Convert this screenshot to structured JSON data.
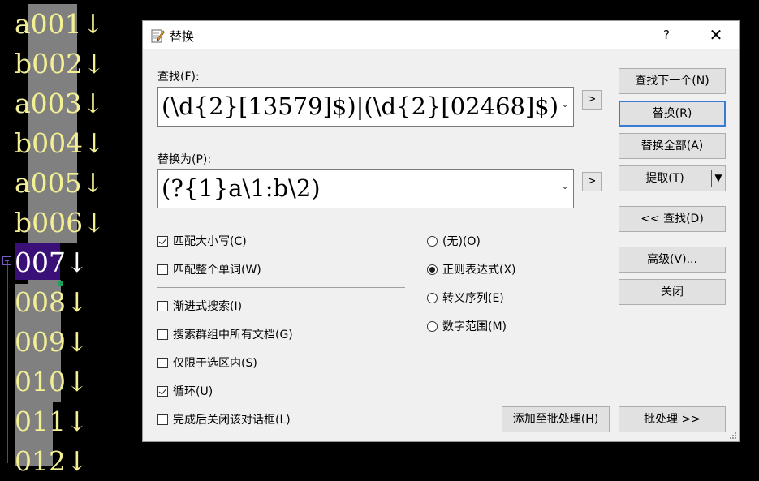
{
  "editor": {
    "lines": [
      "a001↓",
      "b002↓",
      "a003↓",
      "b004↓",
      "a005↓",
      "b006↓",
      "007↓",
      "008↓",
      "009↓",
      "010↓",
      "011↓",
      "012↓"
    ]
  },
  "dialog": {
    "title": "替换",
    "help": "?",
    "close": "✕",
    "find_label": "查找(F):",
    "find_value": "(\\d{2}[13579]$)|(\\d{2}[02468]$)",
    "replace_label": "替换为(P):",
    "replace_value": "(?{1}a\\1:b\\2)",
    "expand_btn": ">",
    "buttons": {
      "find_next": "查找下一个(N)",
      "replace": "替换(R)",
      "replace_all": "替换全部(A)",
      "extract": "提取(T)",
      "find_prev": "<< 查找(D)",
      "advanced": "高级(V)...",
      "close": "关闭",
      "add_batch": "添加至批处理(H)",
      "batch": "批处理 >>"
    },
    "checkboxes": [
      {
        "label": "匹配大小写(C)",
        "checked": true
      },
      {
        "label": "匹配整个单词(W)",
        "checked": false
      },
      {
        "label": "渐进式搜索(I)",
        "checked": false
      },
      {
        "label": "搜索群组中所有文档(G)",
        "checked": false
      },
      {
        "label": "仅限于选区内(S)",
        "checked": false
      },
      {
        "label": "循环(U)",
        "checked": true
      },
      {
        "label": "完成后关闭该对话框(L)",
        "checked": false
      }
    ],
    "radios": [
      {
        "label": "(无)(O)",
        "selected": false
      },
      {
        "label": "正则表达式(X)",
        "selected": true
      },
      {
        "label": "转义序列(E)",
        "selected": false
      },
      {
        "label": "数字范围(M)",
        "selected": false
      }
    ]
  }
}
